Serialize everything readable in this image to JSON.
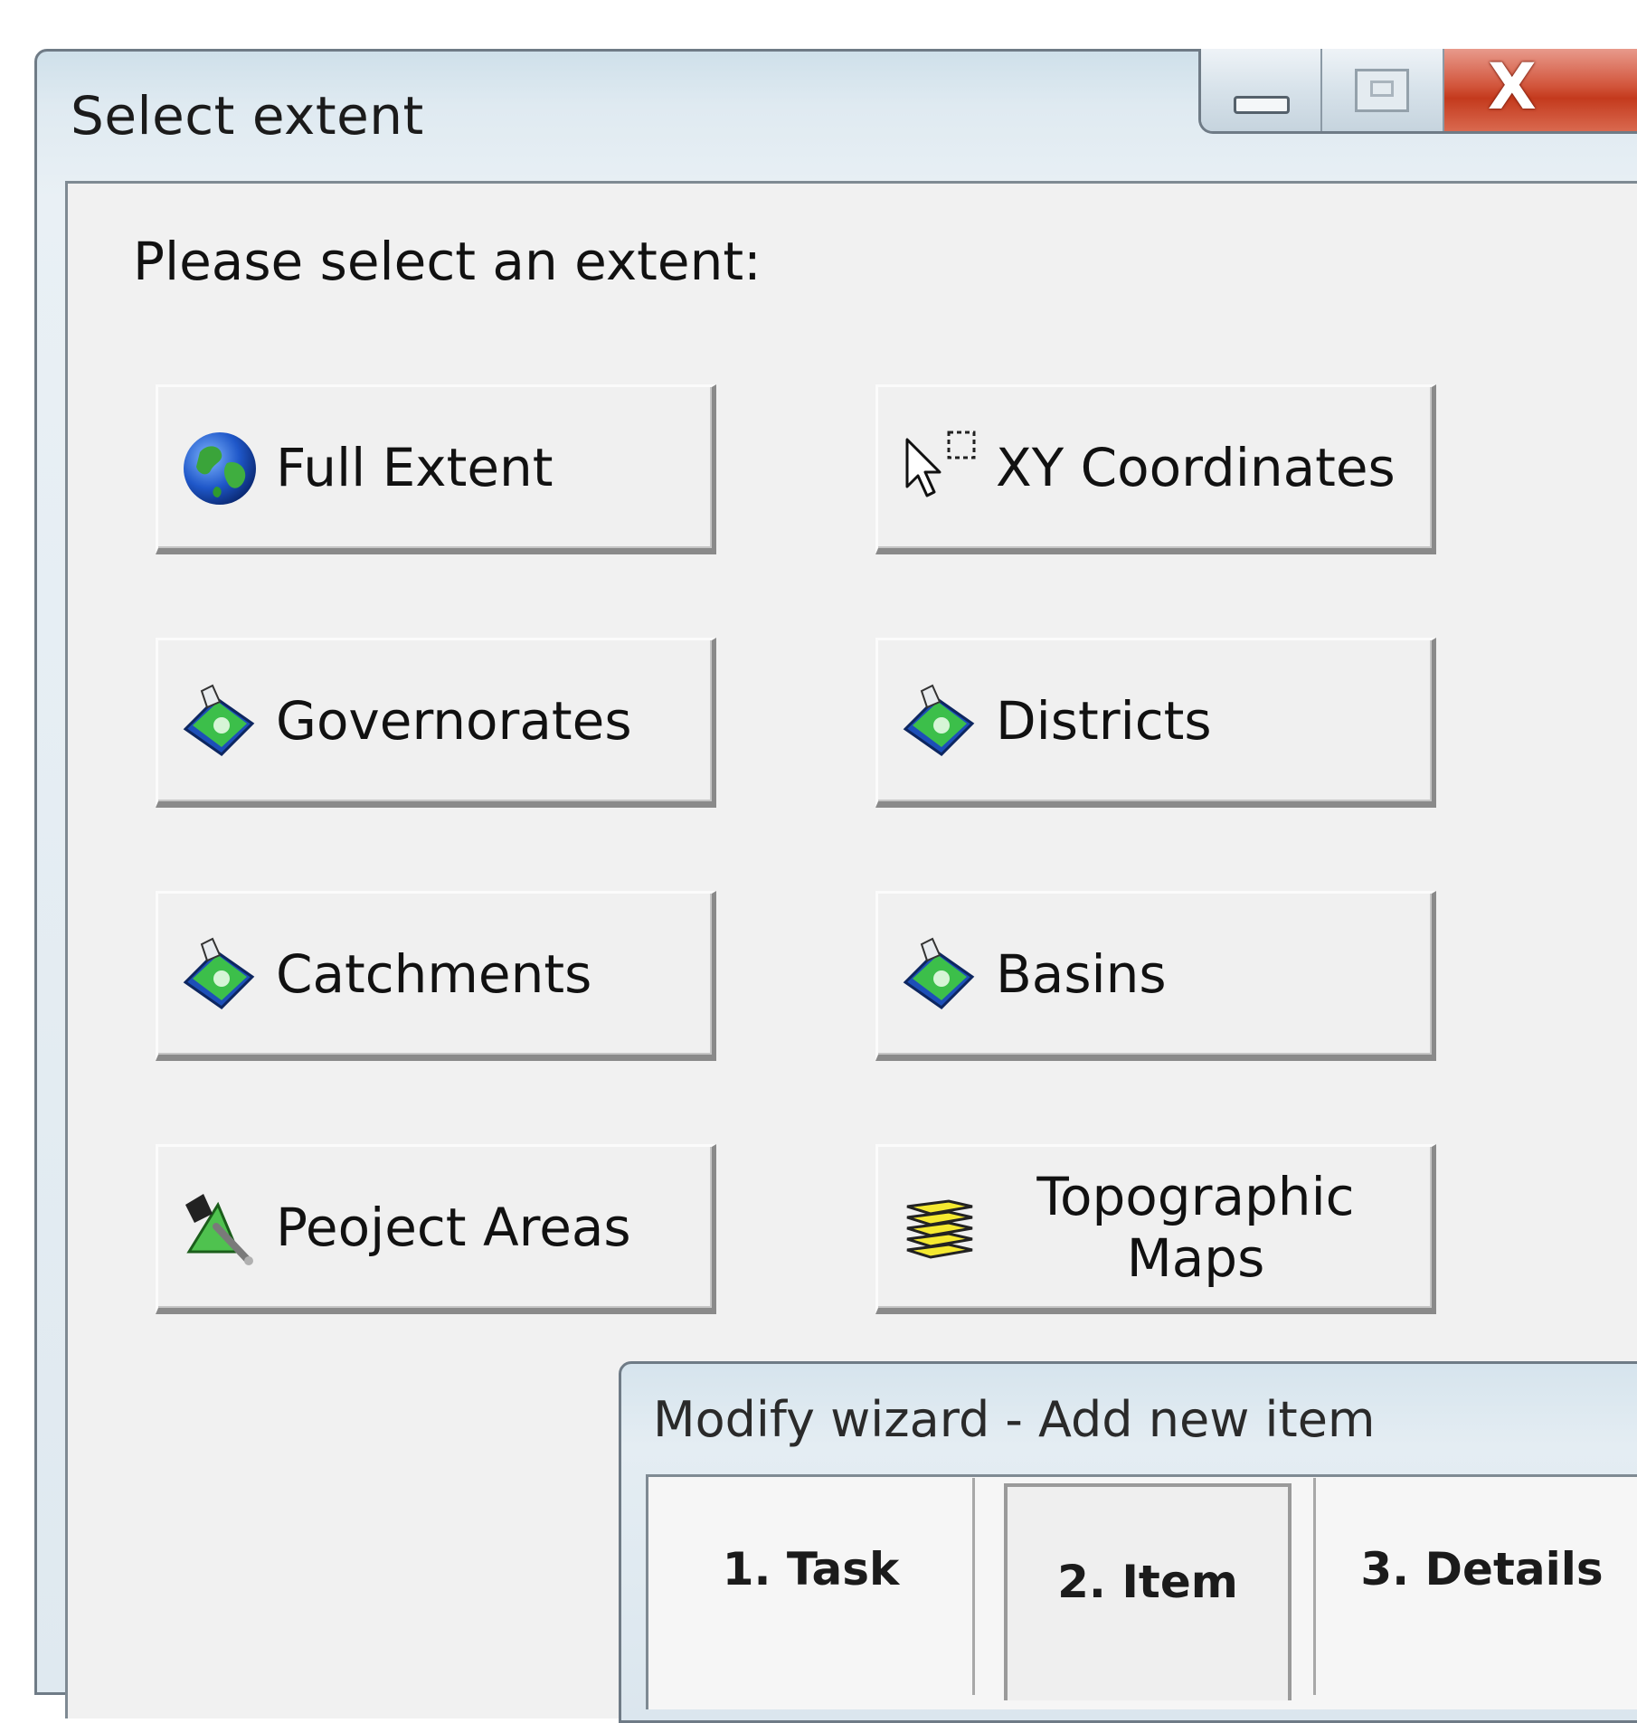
{
  "window": {
    "title": "Select extent",
    "controls": [
      "minimize-icon",
      "maximize-icon",
      "close-icon"
    ]
  },
  "prompt": "Please select an extent:",
  "buttons": {
    "full_extent": {
      "label": "Full Extent",
      "icon": "globe-icon"
    },
    "xy_coordinates": {
      "label": "XY Coordinates",
      "icon": "cursor-select-icon"
    },
    "governorates": {
      "label": "Governorates",
      "icon": "map-layer-icon"
    },
    "districts": {
      "label": "Districts",
      "icon": "map-layer-icon"
    },
    "catchments": {
      "label": "Catchments",
      "icon": "map-layer-icon"
    },
    "basins": {
      "label": "Basins",
      "icon": "map-layer-icon"
    },
    "project_areas": {
      "label": "Peoject Areas",
      "icon": "area-edit-icon"
    },
    "topographic_maps": {
      "label_line1": "Topographic",
      "label_line2": "Maps",
      "icon": "layers-stack-icon"
    }
  },
  "wizard": {
    "title": "Modify wizard - Add new item",
    "steps": [
      {
        "label": "1. Task"
      },
      {
        "label": "2. Item",
        "selected": true
      },
      {
        "label": "3. Details"
      }
    ]
  },
  "colors": {
    "close_button": "#c43a1d",
    "title_bar": "#dfeaf1",
    "client_bg": "#f1f1f1"
  }
}
